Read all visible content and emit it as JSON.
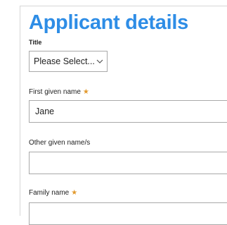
{
  "form": {
    "heading": "Applicant details",
    "required_marker": "★",
    "title_field": {
      "label": "Title",
      "selected": "Please Select..."
    },
    "first_given_name": {
      "label": "First given name",
      "value": "Jane"
    },
    "other_given_names": {
      "label": "Other given name/s",
      "value": ""
    },
    "family_name": {
      "label": "Family name",
      "value": ""
    }
  },
  "colors": {
    "heading": "#2e8de6",
    "required": "#e29a2e",
    "border": "#a9a9a9"
  },
  "icons": {
    "select_chevron": "chevron-down-icon"
  }
}
